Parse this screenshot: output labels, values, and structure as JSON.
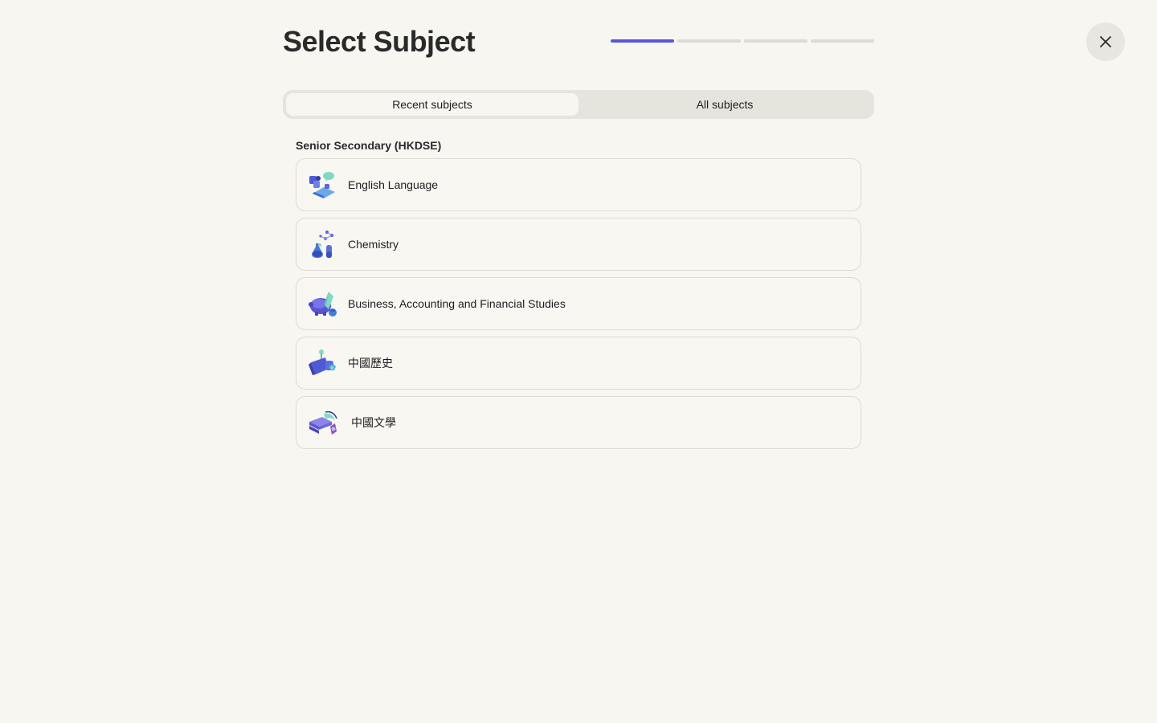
{
  "header": {
    "title": "Select Subject",
    "progress": {
      "total_steps": 4,
      "current_step": 1
    },
    "close_icon": "close-icon"
  },
  "tabs": [
    {
      "label": "Recent subjects",
      "active": true
    },
    {
      "label": "All subjects",
      "active": false
    }
  ],
  "section": {
    "heading": "Senior Secondary (HKDSE)",
    "subjects": [
      {
        "label": "English Language",
        "icon": "language-books-icon"
      },
      {
        "label": "Chemistry",
        "icon": "flask-molecule-icon"
      },
      {
        "label": "Business, Accounting and Financial Studies",
        "icon": "piggy-bank-icon"
      },
      {
        "label": "中國歷史",
        "icon": "history-scroll-icon"
      },
      {
        "label": "中國文學",
        "icon": "literature-books-icon"
      }
    ]
  },
  "colors": {
    "accent": "#5a55dd",
    "background": "#f7f6f1",
    "track": "#dcdbd4"
  }
}
